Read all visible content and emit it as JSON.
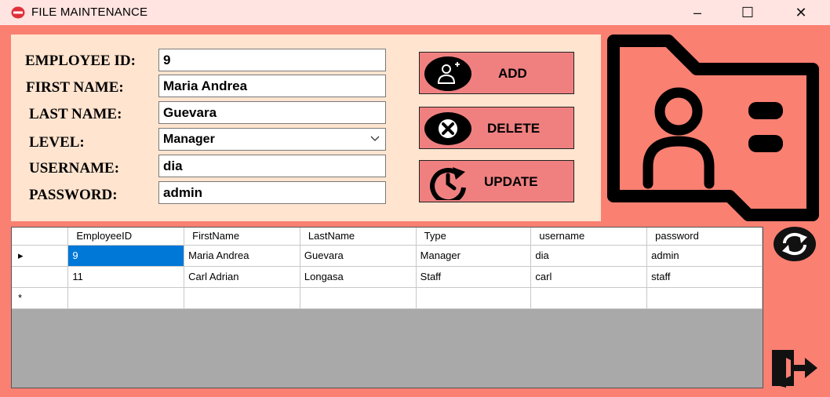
{
  "window": {
    "title": "FILE MAINTENANCE",
    "minimize": "–",
    "maximize": "☐",
    "close": "✕"
  },
  "form": {
    "employee_id": {
      "label": "EMPLOYEE ID:",
      "value": "9"
    },
    "first_name": {
      "label": "FIRST NAME:",
      "value": "Maria Andrea"
    },
    "last_name": {
      "label": "LAST NAME:",
      "value": "Guevara"
    },
    "level": {
      "label": "LEVEL:",
      "value": "Manager"
    },
    "username": {
      "label": "USERNAME:",
      "value": "dia"
    },
    "password": {
      "label": "PASSWORD:",
      "value": "admin"
    }
  },
  "buttons": {
    "add": "ADD",
    "delete": "DELETE",
    "update": "UPDATE"
  },
  "icons": {
    "add": "add-user-icon",
    "delete": "delete-x-icon",
    "update": "clock-refresh-icon",
    "profile": "contact-folder-icon",
    "refresh": "refresh-icon",
    "exit": "exit-door-icon"
  },
  "grid": {
    "columns": [
      "EmployeeID",
      "FirstName",
      "LastName",
      "Type",
      "username",
      "password"
    ],
    "rows": [
      [
        "9",
        "Maria Andrea",
        "Guevara",
        "Manager",
        "dia",
        "admin"
      ],
      [
        "11",
        "Carl Adrian",
        "Longasa",
        "Staff",
        "carl",
        "staff"
      ]
    ],
    "current_row_marker": "▸",
    "new_row_marker": "*"
  },
  "colors": {
    "background": "#fa8072",
    "panel": "#ffe4cf",
    "button": "#f08080",
    "title_bar": "#ffe4e1",
    "selection": "#0078d7"
  }
}
